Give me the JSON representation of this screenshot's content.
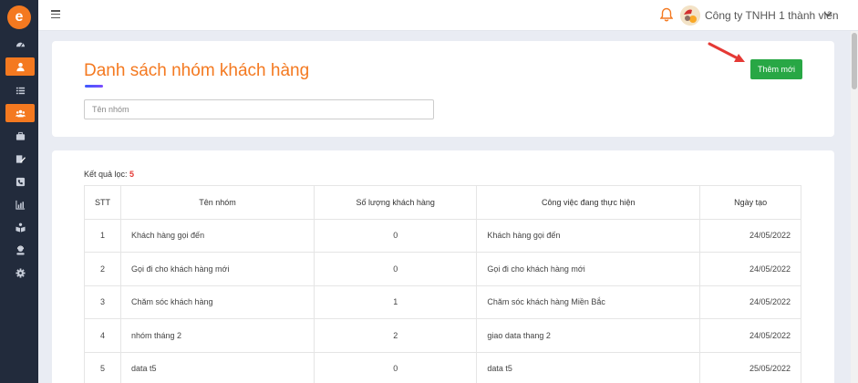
{
  "app": {
    "logo_letter": "e"
  },
  "header": {
    "company": "Công ty TNHH 1 thành viên"
  },
  "page": {
    "title": "Danh sách nhóm khách hàng",
    "search_placeholder": "Tên nhóm",
    "add_label": "Thêm mới",
    "result_label": "Kết quả lọc:",
    "result_count": "5"
  },
  "table": {
    "headers": [
      "STT",
      "Tên nhóm",
      "Số lượng khách hàng",
      "Công việc đang thực hiện",
      "Ngày tạo"
    ],
    "rows": [
      {
        "stt": "1",
        "name": "Khách hàng gọi đến",
        "count": "0",
        "task": "Khách hàng gọi đến",
        "date": "24/05/2022"
      },
      {
        "stt": "2",
        "name": "Gọi đi cho khách hàng mới",
        "count": "0",
        "task": "Gọi đi cho khách hàng mới",
        "date": "24/05/2022"
      },
      {
        "stt": "3",
        "name": "Chăm sóc khách hàng",
        "count": "1",
        "task": "Chăm sóc khách hàng Miền Bắc",
        "date": "24/05/2022"
      },
      {
        "stt": "4",
        "name": "nhóm tháng 2",
        "count": "2",
        "task": "giao data thang 2",
        "date": "24/05/2022"
      },
      {
        "stt": "5",
        "name": "data t5",
        "count": "0",
        "task": "data t5",
        "date": "25/05/2022"
      }
    ]
  },
  "colors": {
    "accent": "#f47920",
    "sidebar": "#222b3c",
    "add_button": "#28a745",
    "count_red": "#e53935"
  },
  "sidebar_icons": [
    "dashboard-icon",
    "user-icon",
    "list-icon",
    "users-icon",
    "briefcase-icon",
    "edit-icon",
    "phone-icon",
    "chart-icon",
    "book-icon",
    "agent-icon",
    "gear-icon"
  ]
}
